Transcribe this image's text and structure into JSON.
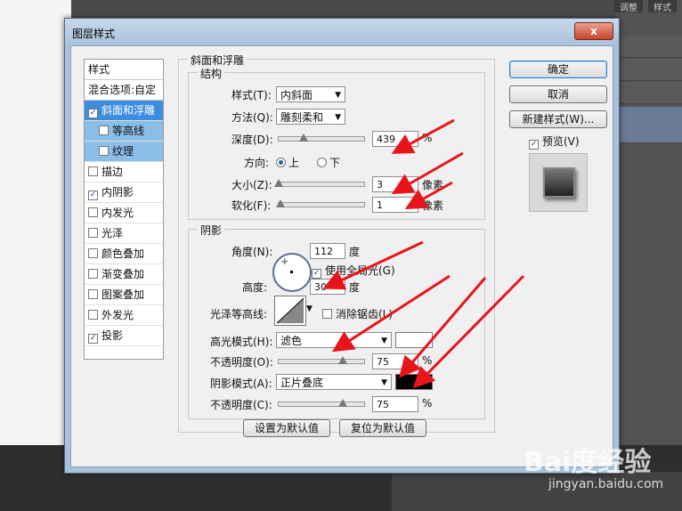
{
  "background": {
    "panel_tabs": [
      "调整",
      "样式"
    ]
  },
  "dialog": {
    "title": "图层样式",
    "close_label": "x"
  },
  "styles_list": {
    "header": "样式",
    "blend_options": "混合选项:自定",
    "items": [
      {
        "label": "斜面和浮雕",
        "checked": true,
        "selected": true,
        "sub": false
      },
      {
        "label": "等高线",
        "checked": false,
        "selected": false,
        "sub": true
      },
      {
        "label": "纹理",
        "checked": false,
        "selected": false,
        "sub": true
      },
      {
        "label": "描边",
        "checked": false,
        "selected": false,
        "sub": false
      },
      {
        "label": "内阴影",
        "checked": true,
        "selected": false,
        "sub": false
      },
      {
        "label": "内发光",
        "checked": false,
        "selected": false,
        "sub": false
      },
      {
        "label": "光泽",
        "checked": false,
        "selected": false,
        "sub": false
      },
      {
        "label": "颜色叠加",
        "checked": false,
        "selected": false,
        "sub": false
      },
      {
        "label": "渐变叠加",
        "checked": false,
        "selected": false,
        "sub": false
      },
      {
        "label": "图案叠加",
        "checked": false,
        "selected": false,
        "sub": false
      },
      {
        "label": "外发光",
        "checked": false,
        "selected": false,
        "sub": false
      },
      {
        "label": "投影",
        "checked": true,
        "selected": false,
        "sub": false
      }
    ]
  },
  "bevel": {
    "section_title": "斜面和浮雕",
    "structure": {
      "title": "结构",
      "style_label": "样式(T):",
      "style_value": "内斜面",
      "technique_label": "方法(Q):",
      "technique_value": "雕刻柔和",
      "depth_label": "深度(D):",
      "depth_value": "439",
      "depth_unit": "%",
      "depth_level": 0.29,
      "direction_label": "方向:",
      "direction_up": "上",
      "direction_down": "下",
      "size_label": "大小(Z):",
      "size_value": "3",
      "size_unit": "像素",
      "size_level": 0.0,
      "soften_label": "软化(F):",
      "soften_value": "1",
      "soften_unit": "像素",
      "soften_level": 0.02
    },
    "shading": {
      "title": "阴影",
      "angle_label": "角度(N):",
      "angle_value": "112",
      "angle_unit": "度",
      "global_light_label": "使用全局光(G)",
      "global_light_checked": true,
      "altitude_label": "高度:",
      "altitude_value": "30",
      "altitude_unit": "度",
      "gloss_contour_label": "光泽等高线:",
      "anti_alias_label": "消除锯齿(L)",
      "anti_alias_checked": false,
      "highlight_mode_label": "高光模式(H):",
      "highlight_mode_value": "滤色",
      "highlight_color": "#ffffff",
      "highlight_opacity_label": "不透明度(O):",
      "highlight_opacity_value": "75",
      "highlight_opacity_unit": "%",
      "highlight_opacity_level": 0.75,
      "shadow_mode_label": "阴影模式(A):",
      "shadow_mode_value": "正片叠底",
      "shadow_color": "#000000",
      "shadow_opacity_label": "不透明度(C):",
      "shadow_opacity_value": "75",
      "shadow_opacity_unit": "%",
      "shadow_opacity_level": 0.75
    },
    "make_default": "设置为默认值",
    "reset_default": "复位为默认值"
  },
  "buttons": {
    "ok": "确定",
    "cancel": "取消",
    "new_style": "新建样式(W)...",
    "preview_label": "预览(V)",
    "preview_checked": true
  },
  "watermark": {
    "logo": "Bai度经验",
    "url": "jingyan.baidu.com"
  },
  "colors": {
    "annotation_arrow": "#e8141b",
    "selection": "#3d8ee0"
  }
}
